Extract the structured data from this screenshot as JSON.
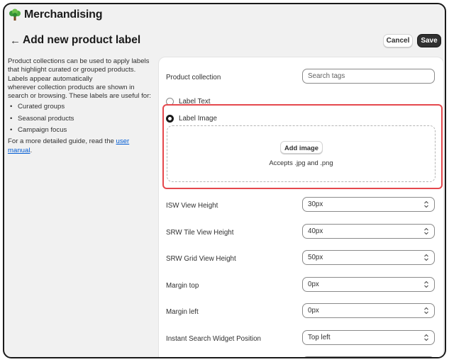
{
  "app": {
    "title": "Merchandising",
    "logo_icon": "tree-icon"
  },
  "page": {
    "back_icon": "←",
    "title": "Add new product label",
    "cancel_label": "Cancel",
    "save_label": "Save"
  },
  "help": {
    "intro_1": "Product collections can be used to apply labels",
    "intro_2": "that highlight curated or grouped products.",
    "intro_3": "Labels appear automatically",
    "intro_4": "wherever collection products are shown in",
    "intro_5": "search or browsing. These labels are useful for:",
    "bullets": [
      "Curated groups",
      "Seasonal products",
      "Campaign focus"
    ],
    "guide_prefix": "For a more detailed guide, read the",
    "link_part1": "user",
    "link_part2": "manual",
    "guide_suffix": "."
  },
  "form": {
    "collection_label": "Product collection",
    "collection_placeholder": "Search tags",
    "label_text_option": "Label Text",
    "label_image_option": "Label Image",
    "selected_option": "Label Image",
    "add_image_label": "Add image",
    "accepts_text": "Accepts .jpg and .png",
    "fields": [
      {
        "label": "ISW View Height",
        "value": "30px"
      },
      {
        "label": "SRW Tile View Height",
        "value": "40px"
      },
      {
        "label": "SRW Grid View Height",
        "value": "50px"
      },
      {
        "label": "Margin top",
        "value": "0px"
      },
      {
        "label": "Margin left",
        "value": "0px"
      },
      {
        "label": "Instant Search Widget Position",
        "value": "Top left"
      }
    ]
  },
  "colors": {
    "highlight": "#e5484d",
    "primary": "#303030",
    "link": "#005bd3"
  }
}
